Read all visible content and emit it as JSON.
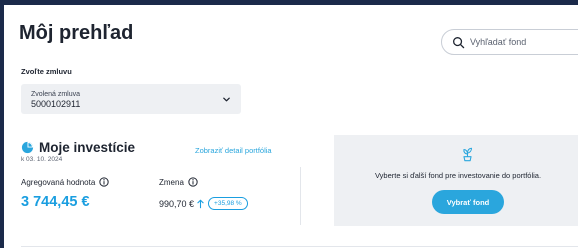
{
  "page": {
    "title": "Môj prehľad"
  },
  "search": {
    "placeholder": "Vyhľadať fond",
    "icon": "search-icon"
  },
  "contract": {
    "section_label": "Zvoľte zmluvu",
    "select_label": "Zvolená zmluva",
    "selected_value": "5000102911"
  },
  "investments": {
    "title": "Moje investície",
    "date": "k 03. 10. 2024",
    "detail_link": "Zobraziť detail portfólia",
    "aggregated_label": "Agregovaná hodnota",
    "aggregated_value": "3 744,45 €",
    "change_label": "Zmena",
    "change_value": "990,70 €",
    "change_percent": "+35,98 %"
  },
  "promo": {
    "text": "Vyberte si ďalší fond pre investovanie do portfólia.",
    "button_label": "Vybrať fond"
  },
  "colors": {
    "accent": "#2aa6dd",
    "value_blue": "#1a9ee0",
    "frame_dark": "#1b2a4a",
    "panel_grey": "#eef0f3"
  }
}
